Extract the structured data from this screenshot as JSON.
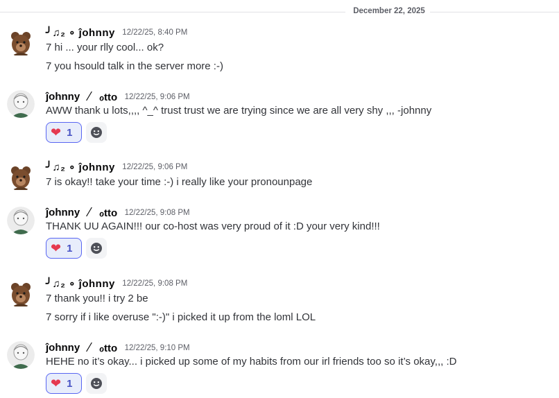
{
  "divider": {
    "date": "December 22, 2025"
  },
  "messages": [
    {
      "author": "╯♫₂    ∘   ĵohnny",
      "timestamp": "12/22/25, 8:40 PM",
      "lines": [
        "7 hi ... your rlly cool... ok?",
        "7 you hsould talk in the server more :-)"
      ]
    },
    {
      "author": "ĵohnny",
      "author2": "ℴtto",
      "timestamp": "12/22/25, 9:06 PM",
      "lines": [
        "AWW thank u lots,,,, ^_^ trust trust we are trying since we are all very shy ,,, -johnny"
      ],
      "reaction": {
        "emoji": "❤",
        "count": "1"
      }
    },
    {
      "author": "╯♫₂    ∘   ĵohnny",
      "timestamp": "12/22/25, 9:06 PM",
      "lines": [
        "7 is okay!! take your time :-) i really like your pronounpage"
      ]
    },
    {
      "author": "ĵohnny",
      "author2": "ℴtto",
      "timestamp": "12/22/25, 9:08 PM",
      "lines": [
        "THANK UU AGAIN!!! our co-host was very proud of it :D your very kind!!!"
      ],
      "reaction": {
        "emoji": "❤",
        "count": "1"
      }
    },
    {
      "author": "╯♫₂    ∘   ĵohnny",
      "timestamp": "12/22/25, 9:08 PM",
      "lines": [
        "7 thank you!! i try 2 be",
        "7 sorry if i like overuse \":-)\" i picked it up from the loml LOL"
      ]
    },
    {
      "author": "ĵohnny",
      "author2": "ℴtto",
      "timestamp": "12/22/25, 9:10 PM",
      "lines": [
        "HEHE no it’s okay... i picked up some of my habits from our irl friends too so it’s okay,,, :D"
      ],
      "reaction": {
        "emoji": "❤",
        "count": "1"
      }
    }
  ],
  "colors": {
    "accent": "#5865f2",
    "heart": "#e53950",
    "reaction_bg": "#e8edfb"
  }
}
